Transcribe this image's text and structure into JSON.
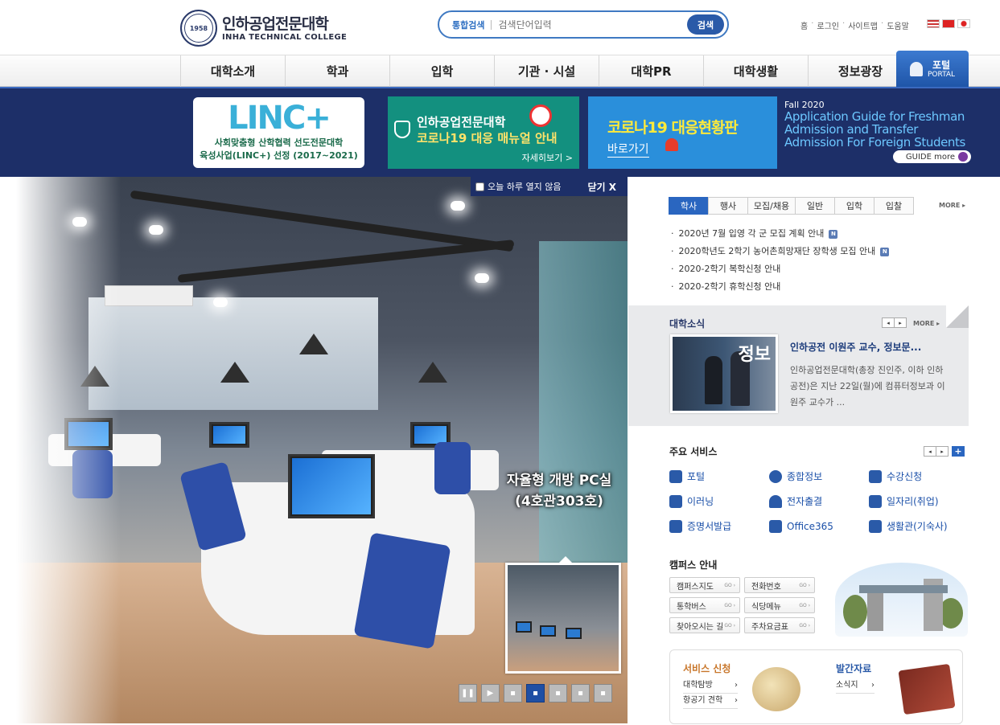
{
  "header": {
    "logo_ko": "인하공업전문대학",
    "logo_en": "INHA TECHNICAL COLLEGE",
    "logo_year": "1958",
    "search_label": "통합검색",
    "search_placeholder": "검색단어입력",
    "search_button": "검색",
    "util": [
      "홈",
      "로그인",
      "사이트맵",
      "도움말"
    ],
    "flags": [
      "us-flag",
      "china-flag",
      "japan-flag"
    ]
  },
  "nav": {
    "items": [
      "대학소개",
      "학과",
      "입학",
      "기관 · 시설",
      "대학PR",
      "대학생활",
      "정보광장"
    ],
    "portal_ko": "포털",
    "portal_en": "PORTAL"
  },
  "banners": {
    "linc_logo_main": "LINC",
    "linc_logo_plus": "+",
    "linc_line1": "사회맞춤형 산학협력 선도전문대학",
    "linc_line2": "육성사업(LINC+) 선정 (2017~2021)",
    "covid_line1": "인하공업전문대학",
    "covid_line2": "코로나19 대응 매뉴얼 안내",
    "covid_more": "자세히보기 >",
    "status_line1": "코로나19 대응현황판",
    "status_line2": "바로가기",
    "guide_year": "Fall 2020",
    "guide_title": "Application Guide for Freshman Admission and Transfer Admission For Foreign Students",
    "guide_button": "GUIDE more"
  },
  "popup": {
    "checkbox_label": "오늘 하루 열지 않음",
    "close_label": "닫기 X",
    "caption_line1": "자율형 개방 PC실",
    "caption_line2": "(4호관303호)"
  },
  "notice": {
    "tabs": [
      "학사",
      "행사",
      "모집/채용",
      "일반",
      "입학",
      "입찰"
    ],
    "active_tab": "학사",
    "more": "MORE ▸",
    "items": [
      {
        "text": "2020년 7월 입영 각 군 모집 계획 안내",
        "new": "N"
      },
      {
        "text": "2020학년도 2학기 농어촌희망재단 장학생 모집 안내",
        "new": "N"
      },
      {
        "text": "2020-2학기 복학신청 안내",
        "new": ""
      },
      {
        "text": "2020-2학기 휴학신청 안내",
        "new": ""
      }
    ]
  },
  "news": {
    "title": "대학소식",
    "more": "MORE ▸",
    "headline": "인하공전 이원주 교수, 정보문...",
    "body": "인하공업전문대학(총장 진인주, 이하 인하공전)은 지난 22일(월)에 컴퓨터정보과 이원주 교수가 ...",
    "photo_sign": "정보"
  },
  "services": {
    "title": "주요 서비스",
    "items": [
      {
        "label": "포털",
        "icon": "portal-icon"
      },
      {
        "label": "종합정보",
        "icon": "gear-icon"
      },
      {
        "label": "수강신청",
        "icon": "monitor-icon"
      },
      {
        "label": "이러닝",
        "icon": "elearning-icon"
      },
      {
        "label": "전자출결",
        "icon": "bell-icon"
      },
      {
        "label": "일자리(취업)",
        "icon": "job-icon"
      },
      {
        "label": "증명서발급",
        "icon": "certificate-icon"
      },
      {
        "label": "Office365",
        "icon": "office-icon"
      },
      {
        "label": "생활관(기숙사)",
        "icon": "dormitory-icon"
      }
    ]
  },
  "campus": {
    "title": "캠퍼스 안내",
    "go": "GO ›",
    "items": [
      "캠퍼스지도",
      "전화번호",
      "통학버스",
      "식당메뉴",
      "찾아오시는 길",
      "주차요금표"
    ]
  },
  "bottom": {
    "service_title": "서비스 신청",
    "service_items": [
      "대학탐방",
      "항공기 견학"
    ],
    "pub_title": "발간자료",
    "pub_items": [
      "소식지"
    ]
  }
}
